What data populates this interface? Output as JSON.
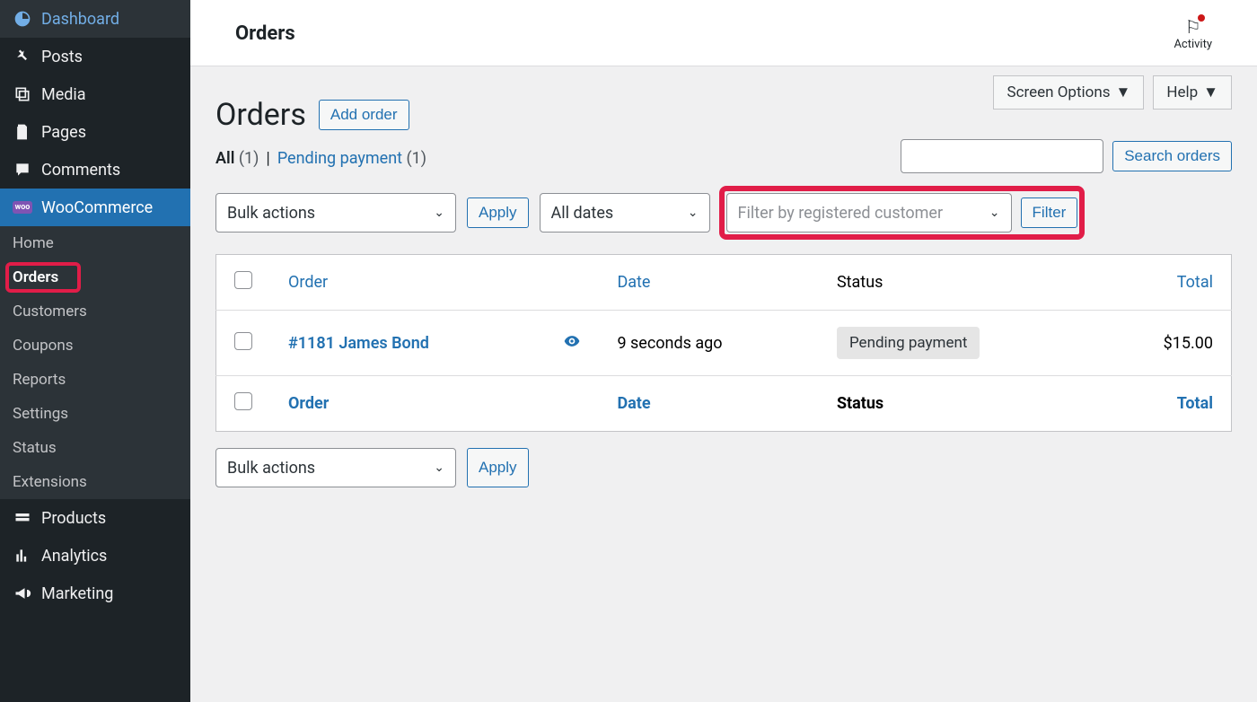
{
  "sidebar": {
    "items": [
      {
        "label": "Dashboard",
        "icon": "dashboard-icon"
      },
      {
        "label": "Posts",
        "icon": "pin-icon"
      },
      {
        "label": "Media",
        "icon": "media-icon"
      },
      {
        "label": "Pages",
        "icon": "pages-icon"
      },
      {
        "label": "Comments",
        "icon": "comment-icon"
      },
      {
        "label": "WooCommerce",
        "icon": "woo-icon"
      },
      {
        "label": "Products",
        "icon": "products-icon"
      },
      {
        "label": "Analytics",
        "icon": "analytics-icon"
      },
      {
        "label": "Marketing",
        "icon": "marketing-icon"
      }
    ],
    "submenu": [
      {
        "label": "Home"
      },
      {
        "label": "Orders"
      },
      {
        "label": "Customers"
      },
      {
        "label": "Coupons"
      },
      {
        "label": "Reports"
      },
      {
        "label": "Settings"
      },
      {
        "label": "Status"
      },
      {
        "label": "Extensions"
      }
    ]
  },
  "topbar": {
    "title": "Orders",
    "activity_label": "Activity"
  },
  "header_options": {
    "screen_options": "Screen Options",
    "help": "Help"
  },
  "page": {
    "heading": "Orders",
    "add_button": "Add order"
  },
  "subsubsub": {
    "all_label": "All",
    "all_count": "(1)",
    "divider": "|",
    "pending_label": "Pending payment",
    "pending_count": "(1)"
  },
  "search": {
    "button": "Search orders"
  },
  "filters": {
    "bulk_actions": "Bulk actions",
    "apply": "Apply",
    "all_dates": "All dates",
    "customer_placeholder": "Filter by registered customer",
    "filter": "Filter"
  },
  "table": {
    "headers": {
      "order": "Order",
      "date": "Date",
      "status": "Status",
      "total": "Total"
    },
    "row": {
      "order": "#1181 James Bond",
      "date": "9 seconds ago",
      "status": "Pending payment",
      "total": "$15.00"
    }
  }
}
